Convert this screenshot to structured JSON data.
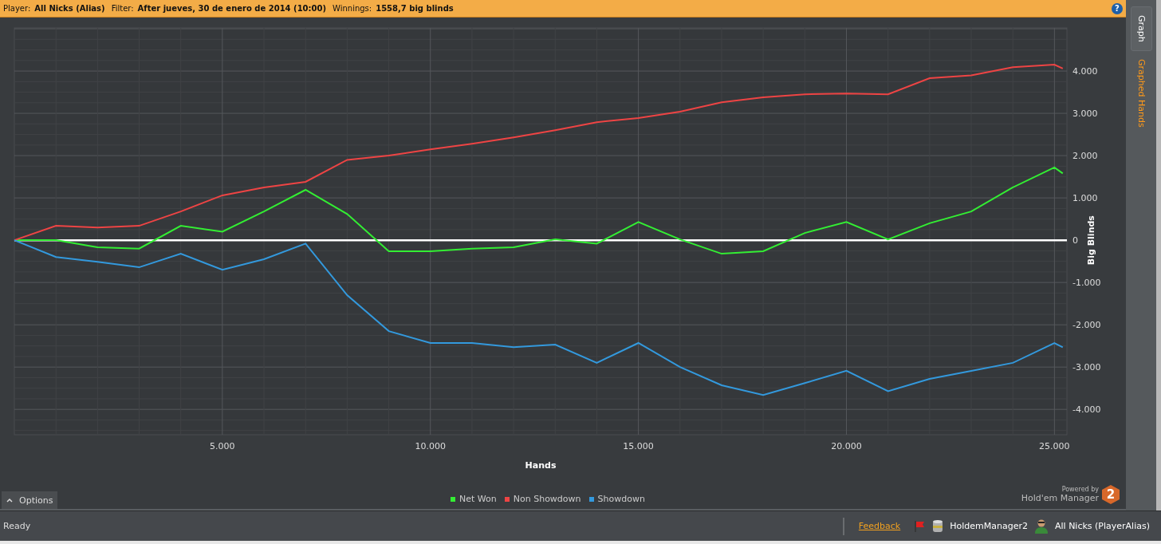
{
  "header": {
    "fields": [
      {
        "label": "Player:",
        "value": "All Nicks (Alias)"
      },
      {
        "label": "Filter:",
        "value": "After jueves, 30 de enero de 2014 (10:00)"
      },
      {
        "label": "Winnings:",
        "value": "1558,7 big blinds"
      }
    ],
    "help": "?"
  },
  "side_tabs": [
    {
      "label": "Graph",
      "selected": true
    },
    {
      "label": "Graphed Hands",
      "selected": false
    }
  ],
  "graph": {
    "chart_data": {
      "type": "line",
      "grid": true,
      "xlabel": "Hands",
      "ylabel": "Big Blinds",
      "x": [
        0,
        1000,
        2000,
        3000,
        4000,
        5000,
        6000,
        7000,
        8000,
        9000,
        10000,
        11000,
        12000,
        13000,
        14000,
        15000,
        16000,
        17000,
        18000,
        19000,
        20000,
        21000,
        22000,
        23000,
        24000,
        25000,
        25200
      ],
      "series": [
        {
          "name": "Net Won",
          "color": "#33ee33",
          "values": [
            0,
            0,
            -170,
            -200,
            340,
            200,
            680,
            1190,
            620,
            -260,
            -260,
            -200,
            -170,
            20,
            -80,
            430,
            20,
            -320,
            -260,
            170,
            430,
            20,
            400,
            680,
            1250,
            1720,
            1580
          ]
        },
        {
          "name": "Non Showdown",
          "color": "#ee4444",
          "values": [
            0,
            340,
            300,
            340,
            680,
            1060,
            1250,
            1380,
            1900,
            2000,
            2150,
            2280,
            2430,
            2600,
            2790,
            2890,
            3040,
            3260,
            3380,
            3450,
            3470,
            3450,
            3830,
            3900,
            4090,
            4150,
            4060
          ]
        },
        {
          "name": "Showdown",
          "color": "#3399dd",
          "values": [
            0,
            -400,
            -510,
            -640,
            -320,
            -700,
            -450,
            -80,
            -1300,
            -2150,
            -2430,
            -2430,
            -2530,
            -2470,
            -2900,
            -2430,
            -3000,
            -3430,
            -3660,
            -3380,
            -3090,
            -3570,
            -3280,
            -3090,
            -2900,
            -2430,
            -2530
          ]
        }
      ],
      "xlim": [
        0,
        25300
      ],
      "ylim": [
        -4600,
        5020
      ],
      "xticks": [
        {
          "value": 5000,
          "label": "5.000"
        },
        {
          "value": 10000,
          "label": "10.000"
        },
        {
          "value": 15000,
          "label": "15.000"
        },
        {
          "value": 20000,
          "label": "20.000"
        },
        {
          "value": 25000,
          "label": "25.000"
        }
      ],
      "yticks": [
        {
          "value": 4000,
          "label": "4.000"
        },
        {
          "value": 3000,
          "label": "3.000"
        },
        {
          "value": 2000,
          "label": "2.000"
        },
        {
          "value": 1000,
          "label": "1.000"
        },
        {
          "value": 0,
          "label": "0"
        },
        {
          "value": -1000,
          "label": "-1.000"
        },
        {
          "value": -2000,
          "label": "-2.000"
        },
        {
          "value": -3000,
          "label": "-3.000"
        },
        {
          "value": -4000,
          "label": "-4.000"
        }
      ]
    }
  },
  "options_button": {
    "label": "Options"
  },
  "branding": {
    "tagline": "Powered by",
    "name": "Hold'em Manager",
    "badge": "2"
  },
  "status_bar": {
    "status": "Ready",
    "feedback_link": "Feedback",
    "database": "HoldemManager2",
    "player": "All Nicks (PlayerAlias)"
  }
}
